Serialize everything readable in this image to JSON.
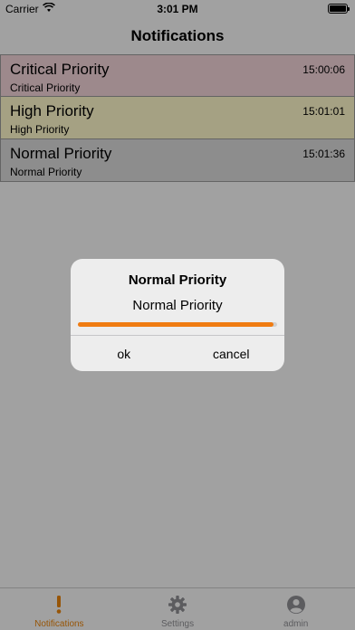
{
  "status_bar": {
    "carrier": "Carrier",
    "time": "3:01 PM"
  },
  "nav": {
    "title": "Notifications"
  },
  "notifications": [
    {
      "title": "Critical Priority",
      "subtitle": "Critical Priority",
      "time": "15:00:06",
      "color": "#f2d3d8"
    },
    {
      "title": "High Priority",
      "subtitle": "High Priority",
      "time": "15:01:01",
      "color": "#fdf7c9"
    },
    {
      "title": "Normal Priority",
      "subtitle": "Normal Priority",
      "time": "15:01:36",
      "color": "#d9d9d9"
    }
  ],
  "alert": {
    "title": "Normal Priority",
    "message": "Normal Priority",
    "progress": 0.98,
    "progress_color": "#f07c12",
    "ok_label": "ok",
    "cancel_label": "cancel"
  },
  "tabs": [
    {
      "label": "Notifications",
      "icon": "exclamation-icon",
      "active": true
    },
    {
      "label": "Settings",
      "icon": "gear-icon",
      "active": false
    },
    {
      "label": "admin",
      "icon": "user-icon",
      "active": false
    }
  ],
  "colors": {
    "accent": "#e8830c",
    "tab_inactive": "#8e8e93"
  }
}
